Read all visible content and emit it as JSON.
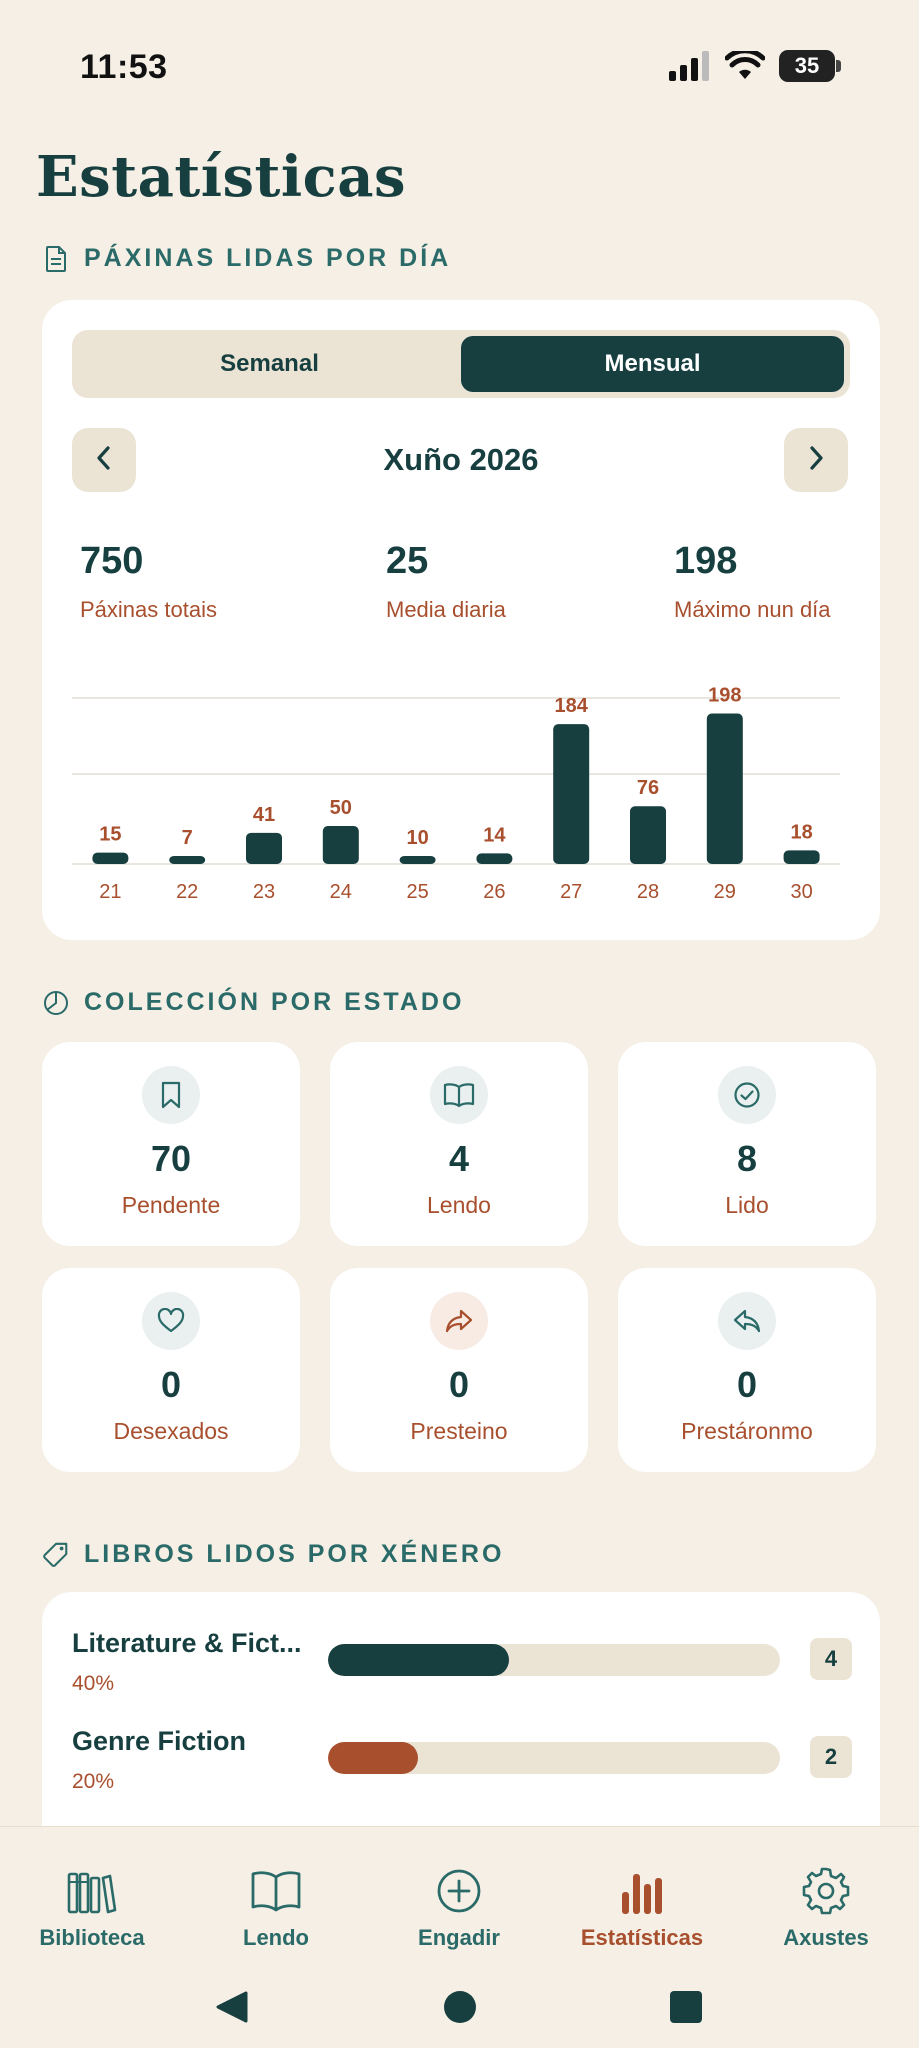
{
  "status": {
    "time": "11:53",
    "battery": "35"
  },
  "page_title": "Estatísticas",
  "pages_section": {
    "header": "PÁXINAS LIDAS POR DÍA",
    "tabs": [
      {
        "label": "Semanal",
        "active": false
      },
      {
        "label": "Mensual",
        "active": true
      }
    ],
    "month": "Xuño 2026",
    "stats": [
      {
        "value": "750",
        "label": "Páxinas totais"
      },
      {
        "value": "25",
        "label": "Media diaria"
      },
      {
        "value": "198",
        "label": "Máximo nun día"
      }
    ]
  },
  "chart_data": {
    "type": "bar",
    "categories": [
      "21",
      "22",
      "23",
      "24",
      "25",
      "26",
      "27",
      "28",
      "29",
      "30"
    ],
    "values": [
      15,
      7,
      41,
      50,
      10,
      14,
      184,
      76,
      198,
      18
    ],
    "ylim": [
      0,
      200
    ],
    "grid": true,
    "bar_color": "#173f40",
    "label_color": "#a84f2e"
  },
  "collection_section": {
    "header": "COLECCIÓN POR ESTADO",
    "tiles": [
      {
        "icon": "bookmark-icon",
        "count": "70",
        "label": "Pendente"
      },
      {
        "icon": "book-open-icon",
        "count": "4",
        "label": "Lendo"
      },
      {
        "icon": "check-circle-icon",
        "count": "8",
        "label": "Lido"
      },
      {
        "icon": "heart-icon",
        "count": "0",
        "label": "Desexados"
      },
      {
        "icon": "share-forward-icon",
        "count": "0",
        "label": "Presteino"
      },
      {
        "icon": "reply-icon",
        "count": "0",
        "label": "Prestáronmo"
      }
    ]
  },
  "genre_section": {
    "header": "LIBROS LIDOS POR XÉNERO",
    "items": [
      {
        "name": "Literature & Fict...",
        "percent": "40%",
        "fraction": 0.4,
        "count": "4",
        "color": "#173f40"
      },
      {
        "name": "Genre Fiction",
        "percent": "20%",
        "fraction": 0.2,
        "count": "2",
        "color": "#a84f2e"
      }
    ]
  },
  "bottom_nav": [
    {
      "icon": "library-icon",
      "label": "Biblioteca",
      "active": false
    },
    {
      "icon": "book-open-icon",
      "label": "Lendo",
      "active": false
    },
    {
      "icon": "plus-circle-icon",
      "label": "Engadir",
      "active": false
    },
    {
      "icon": "bar-chart-icon",
      "label": "Estatísticas",
      "active": true
    },
    {
      "icon": "settings-icon",
      "label": "Axustes",
      "active": false
    }
  ],
  "colors": {
    "primary": "#173f40",
    "accent": "#a84f2e",
    "background": "#f5efe5",
    "muted": "#ebe3d4"
  }
}
